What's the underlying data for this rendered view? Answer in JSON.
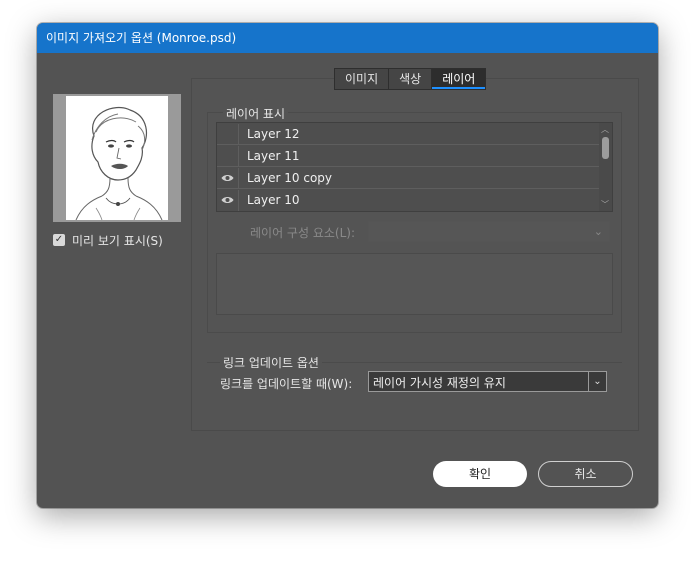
{
  "window": {
    "title": "이미지 가져오기 옵션 (Monroe.psd)"
  },
  "preview": {
    "checkbox_label": "미리 보기 표시(S)",
    "checked": true
  },
  "tabs": [
    {
      "label": "이미지",
      "active": false
    },
    {
      "label": "색상",
      "active": false
    },
    {
      "label": "레이어",
      "active": true
    }
  ],
  "layers_section": {
    "label": "레이어 표시",
    "layers": [
      {
        "name": "Layer 12",
        "visible": false
      },
      {
        "name": "Layer 11",
        "visible": false
      },
      {
        "name": "Layer 10 copy",
        "visible": true
      },
      {
        "name": "Layer 10",
        "visible": true
      }
    ],
    "comp_label": "레이어 구성 요소(L):",
    "comp_value": ""
  },
  "link_section": {
    "label": "링크 업데이트 옵션",
    "field_label": "링크를 업데이트할 때(W):",
    "field_value": "레이어 가시성 재정의 유지"
  },
  "buttons": {
    "ok": "확인",
    "cancel": "취소"
  },
  "colors": {
    "title_bar": "#1674cb",
    "dialog_bg": "#535353",
    "active_tab_underline": "#1e90ff"
  }
}
